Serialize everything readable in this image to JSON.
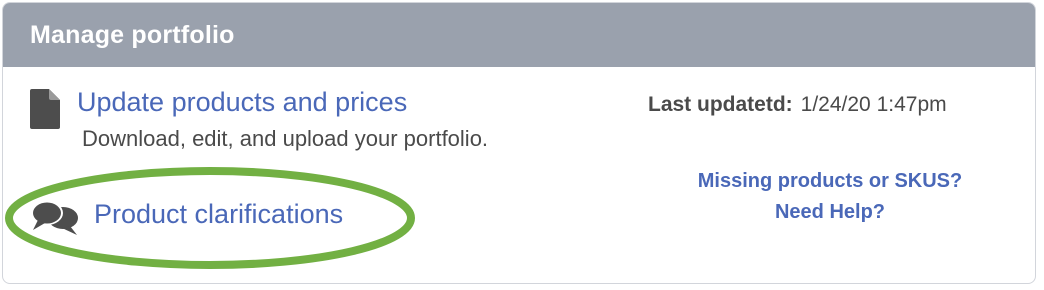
{
  "panel": {
    "title": "Manage portfolio"
  },
  "update": {
    "icon": "document-icon",
    "link_label": "Update products and prices",
    "description": "Download, edit, and upload your portfolio."
  },
  "last_updated": {
    "label": "Last updatetd:",
    "value": "1/24/20 1:47pm"
  },
  "help": {
    "line1": "Missing products or SKUS?",
    "line2": "Need Help?"
  },
  "clarifications": {
    "icon": "chat-bubbles-icon",
    "link_label": "Product clarifications",
    "highlight_color": "#72b043"
  },
  "colors": {
    "header_bg": "#9aa1ad",
    "link": "#4a68b8",
    "text": "#4a4a4a"
  }
}
